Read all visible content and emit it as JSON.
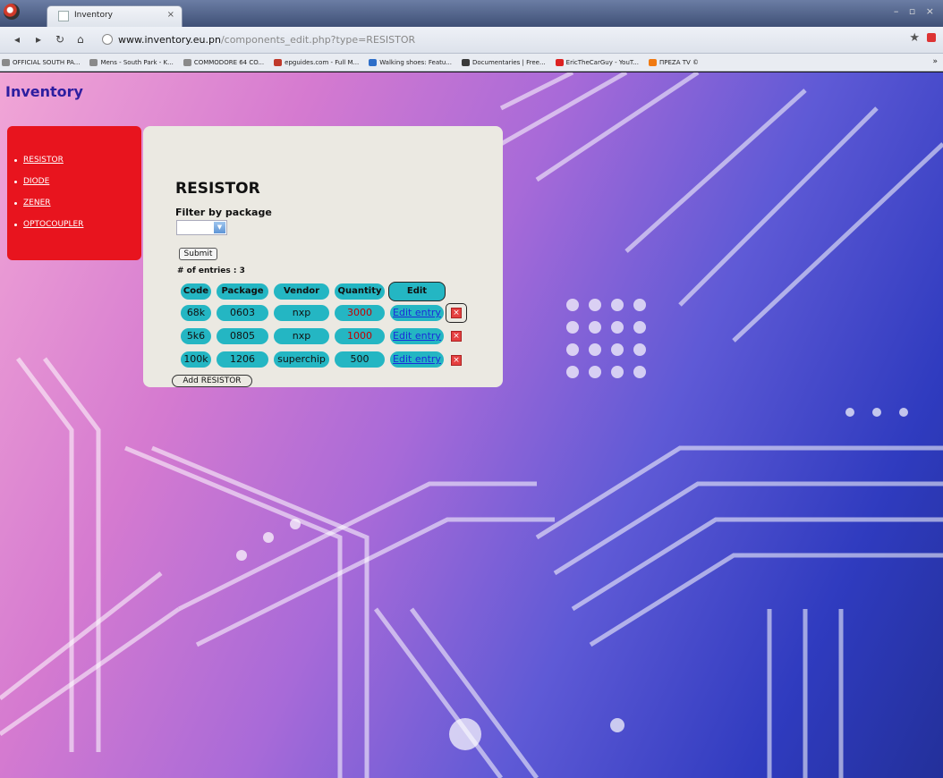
{
  "browser": {
    "tab_title": "Inventory",
    "tab_close": "×",
    "window_controls": "– ▫ ×",
    "url_domain": "www.inventory.eu.pn",
    "url_path": "/components_edit.php?type=RESISTOR",
    "bookmarks": [
      {
        "label": "OFFICIAL SOUTH PA...",
        "color": "#8a8a8a"
      },
      {
        "label": "Mens - South Park - K...",
        "color": "#8a8a8a"
      },
      {
        "label": "COMMODORE 64 CO...",
        "color": "#8a8a8a"
      },
      {
        "label": "epguides.com - Full M...",
        "color": "#c0392b"
      },
      {
        "label": "Walking shoes: Featu...",
        "color": "#2f6fc9"
      },
      {
        "label": "Documentaries | Free...",
        "color": "#3a3a3a"
      },
      {
        "label": "EricTheCarGuy - YouT...",
        "color": "#d22"
      },
      {
        "label": "ΠΡΕΖΑ TV ©",
        "color": "#f07a12"
      }
    ],
    "bookmarks_more": "»"
  },
  "site": {
    "title": "Inventory"
  },
  "sidebar": {
    "items": [
      "RESISTOR",
      "DIODE",
      "ZENER",
      "OPTOCOUPLER"
    ]
  },
  "panel": {
    "heading": "RESISTOR",
    "filter_label": "Filter by package",
    "filter_value": "",
    "submit_label": "Submit",
    "entries_text": "# of entries : 3",
    "columns": [
      "Code",
      "Package",
      "Vendor",
      "Quantity",
      "Edit"
    ],
    "rows": [
      {
        "code": "68k",
        "package": "0603",
        "vendor": "nxp",
        "quantity": "3000",
        "edit": "Edit entry",
        "quantity_color": "red"
      },
      {
        "code": "5k6",
        "package": "0805",
        "vendor": "nxp",
        "quantity": "1000",
        "edit": "Edit entry",
        "quantity_color": "red"
      },
      {
        "code": "100k",
        "package": "1206",
        "vendor": "superchip",
        "quantity": "500",
        "edit": "Edit entry",
        "quantity_color": "black"
      }
    ],
    "delete_glyph": "×",
    "add_label": "Add RESISTOR"
  },
  "colors": {
    "sidebar": "#e8141e",
    "cell": "#24b6c3",
    "title": "#2d1ea0"
  }
}
